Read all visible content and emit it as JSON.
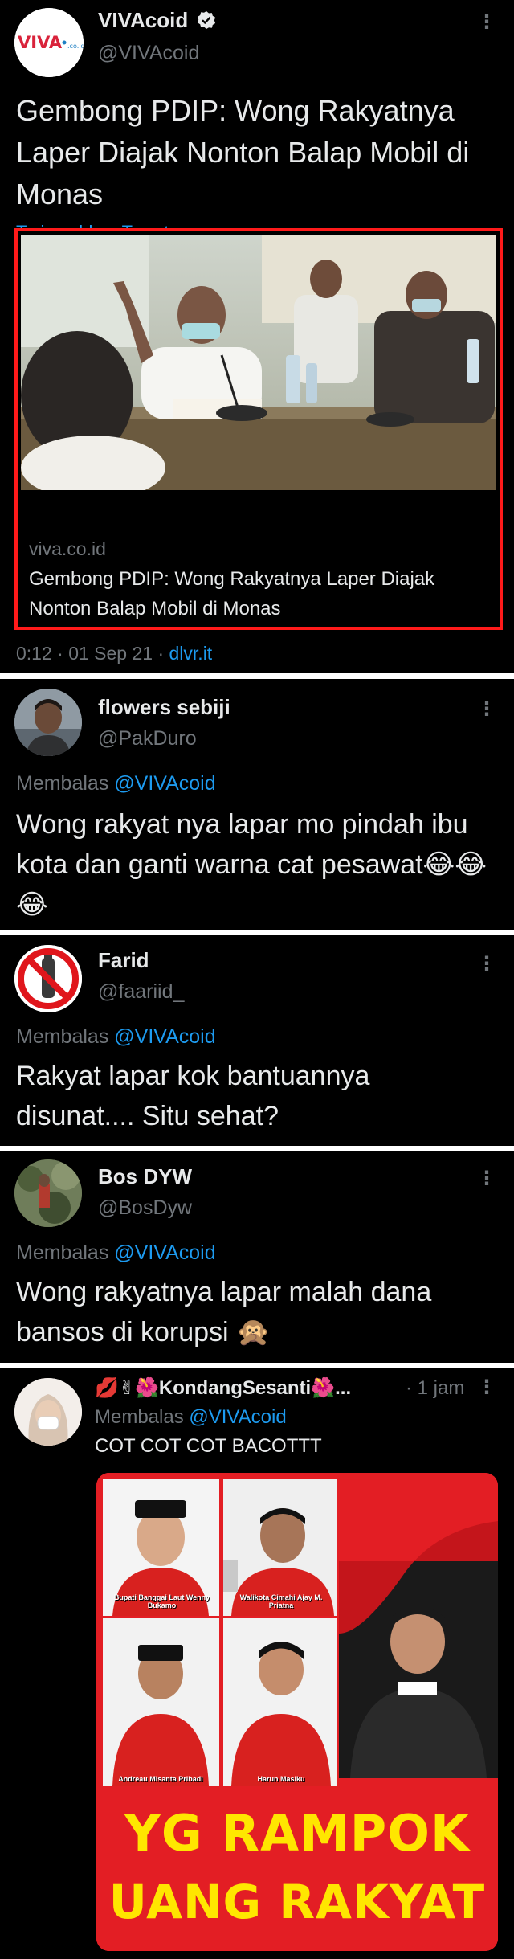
{
  "main_tweet": {
    "name": "VIVAcoid",
    "handle": "@VIVAcoid",
    "avatar_logo": "VIVA",
    "title": "Gembong PDIP: Wong Rakyatnya Laper Diajak Nonton Balap Mobil di Monas",
    "translate": "Terjemahkan Tweet",
    "card": {
      "domain": "viva.co.id",
      "title": "Gembong PDIP: Wong Rakyatnya Laper Diajak Nonton Balap Mobil di Monas"
    },
    "time": "0:12 · 01 Sep 21 · ",
    "source": "dlvr.it"
  },
  "replies": [
    {
      "name": "flowers sebiji",
      "handle": "@PakDuro",
      "replying_label": "Membalas ",
      "replying_to": "@VIVAcoid",
      "text": "Wong rakyat nya lapar mo pindah ibu kota  dan ganti warna cat pesawat😂😂😂"
    },
    {
      "name": "Farid",
      "handle": "@faariid_",
      "replying_label": "Membalas ",
      "replying_to": "@VIVAcoid",
      "text": "Rakyat lapar kok bantuannya disunat.... Situ sehat?"
    },
    {
      "name": "Bos DYW",
      "handle": "@BosDyw",
      "replying_label": "Membalas ",
      "replying_to": "@VIVAcoid",
      "text": "Wong rakyatnya lapar malah dana bansos di korupsi 🙊"
    },
    {
      "name": "💋✌🌺KondangSesanti🌺...",
      "time": "· 1 jam",
      "replying_label": "Membalas ",
      "replying_to": "@VIVAcoid",
      "text": "COT COT COT BACOTTT"
    }
  ],
  "poster": {
    "line1": "YG RAMPOK",
    "line2": "UANG RAKYAT",
    "captions": [
      "Bupati Banggai Laut Wenny Bukamo",
      "Walikota Cimahi Ajay M. Priatna",
      "Andreau Misanta Pribadi",
      "Harun Masiku"
    ]
  },
  "colors": {
    "background": "#000000",
    "text": "#e7e9ea",
    "secondary": "#71767b",
    "link": "#1d9bf0",
    "highlight": "#ff1a1a",
    "poster_red": "#e31e24",
    "poster_yellow": "#ffe600"
  },
  "icons": [
    "verified-badge-icon",
    "more-options-icon"
  ]
}
